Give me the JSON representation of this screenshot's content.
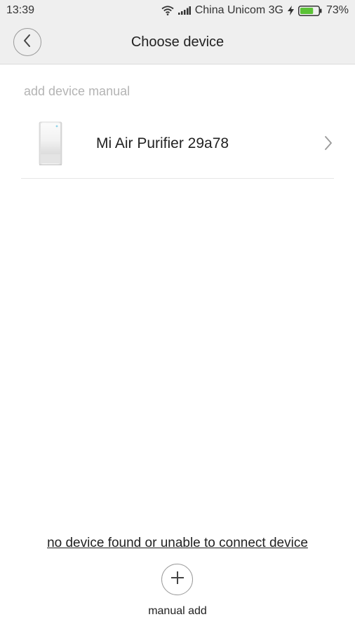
{
  "status_bar": {
    "time": "13:39",
    "carrier": "China Unicom 3G",
    "battery_percent": "73%",
    "battery_level": 0.73,
    "battery_color": "#5bc236"
  },
  "header": {
    "title": "Choose device",
    "back_icon": "chevron-left-icon"
  },
  "main": {
    "section_label": "add device manual",
    "devices": [
      {
        "name": "Mi Air Purifier 29a78",
        "icon": "air-purifier-image"
      }
    ]
  },
  "footer": {
    "no_device_link": "no device found or unable to connect device",
    "add_icon": "plus-icon",
    "add_label": "manual add"
  }
}
